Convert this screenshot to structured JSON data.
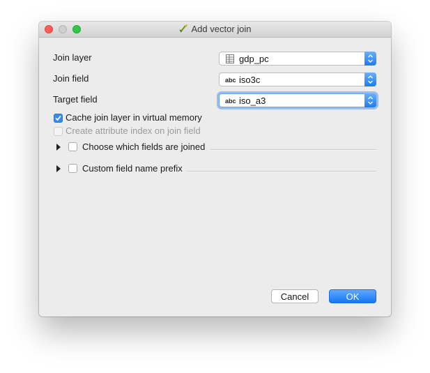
{
  "window": {
    "title": "Add vector join",
    "title_icon": "qgis-join-icon"
  },
  "form": {
    "join_layer": {
      "label": "Join layer",
      "value": "gdp_pc",
      "icon": "table-icon"
    },
    "join_field": {
      "label": "Join field",
      "value": "iso3c",
      "type_badge": "abc"
    },
    "target_field": {
      "label": "Target field",
      "value": "iso_a3",
      "type_badge": "abc"
    }
  },
  "options": {
    "cache": {
      "label": "Cache join layer in virtual memory",
      "checked": true,
      "enabled": true
    },
    "index": {
      "label": "Create attribute index on join field",
      "checked": false,
      "enabled": false
    }
  },
  "groups": {
    "choose_fields": {
      "label": "Choose which fields are joined",
      "checked": false,
      "expanded": false
    },
    "prefix": {
      "label": "Custom field name prefix",
      "checked": false,
      "expanded": false
    }
  },
  "buttons": {
    "cancel": "Cancel",
    "ok": "OK"
  },
  "colors": {
    "accent": "#1677f2",
    "close": "#fc5f57",
    "zoom": "#33c748"
  }
}
